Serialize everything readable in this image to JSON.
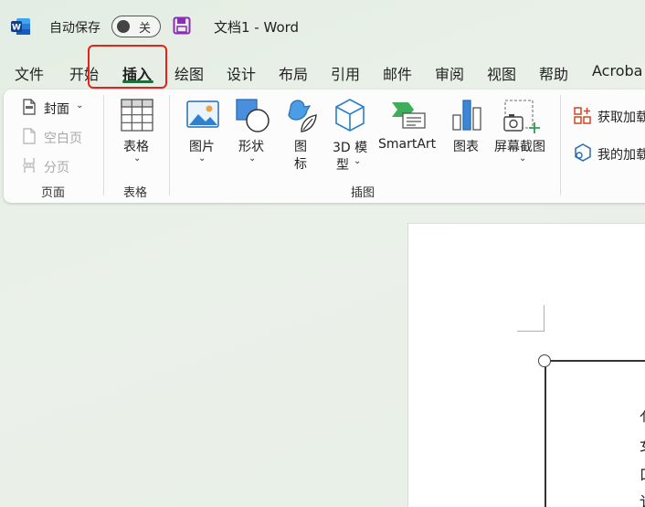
{
  "titlebar": {
    "autosave_label": "自动保存",
    "autosave_state": "关",
    "doc_title": "文档1  -  Word",
    "brand_color": "#185abd"
  },
  "tabs": [
    {
      "label": "文件",
      "active": false
    },
    {
      "label": "开始",
      "active": false
    },
    {
      "label": "插入",
      "active": true
    },
    {
      "label": "绘图",
      "active": false
    },
    {
      "label": "设计",
      "active": false
    },
    {
      "label": "布局",
      "active": false
    },
    {
      "label": "引用",
      "active": false
    },
    {
      "label": "邮件",
      "active": false
    },
    {
      "label": "审阅",
      "active": false
    },
    {
      "label": "视图",
      "active": false
    },
    {
      "label": "帮助",
      "active": false
    },
    {
      "label": "Acroba",
      "active": false
    }
  ],
  "ribbon": {
    "pages_group": {
      "label": "页面",
      "cover": "封面",
      "blank_page": "空白页",
      "page_break": "分页"
    },
    "tables_group": {
      "label": "表格",
      "table": "表格"
    },
    "illustrations_group": {
      "label": "插图",
      "pictures": "图片",
      "shapes": "形状",
      "icons_line1": "图",
      "icons_line2": "标",
      "model_line1": "3D 模",
      "model_line2": "型",
      "smartart": "SmartArt",
      "chart": "图表",
      "screenshot": "屏幕截图"
    },
    "addins_group": {
      "get_addins": "获取加载",
      "my_addins": "我的加载"
    }
  },
  "document": {
    "visible_chars": [
      "亻",
      "女",
      "口",
      "讠"
    ]
  },
  "annotation": {
    "highlight_color": "#e8221b"
  }
}
